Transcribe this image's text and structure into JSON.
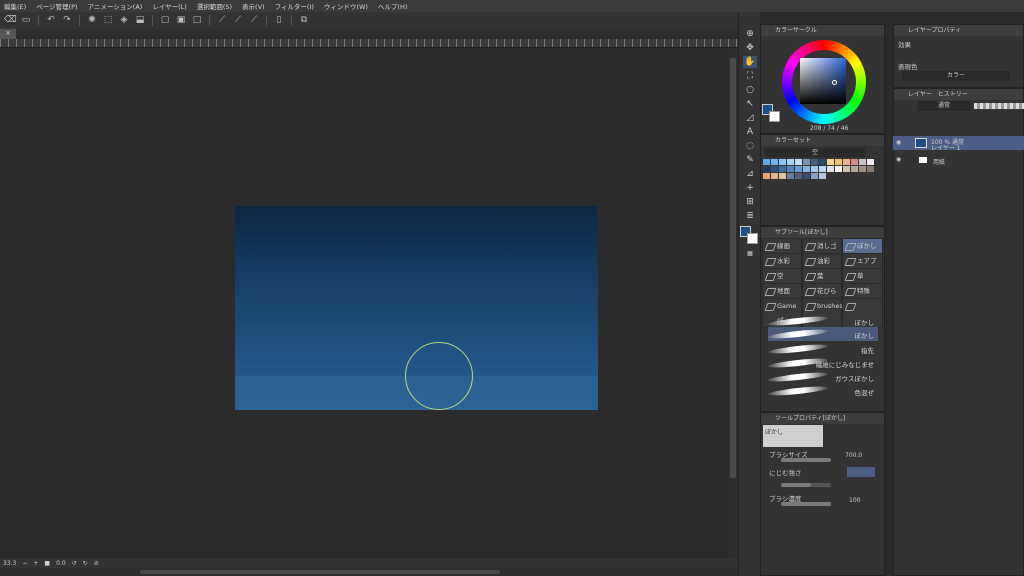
{
  "menu": [
    "編集(E)",
    "ページ管理(P)",
    "アニメーション(A)",
    "レイヤー(L)",
    "選択範囲(S)",
    "表示(V)",
    "フィルター(I)",
    "ウィンドウ(W)",
    "ヘルプ(H)"
  ],
  "canvas": {
    "tab_label": "×",
    "colors": {
      "sky_top": "#0f2540",
      "sky_bottom": "#2a6294",
      "brush_cursor": "#b7d67b"
    }
  },
  "statusbar": {
    "zoom": "33.3",
    "rotation": "0.0"
  },
  "color_circle": {
    "title": "カラーサークル",
    "hsv": {
      "h": "208",
      "s": "74",
      "v": "46"
    },
    "hsv_label": "208 / 74 / 46",
    "main_color": "#1f4f84",
    "sub_color": "#ffffff"
  },
  "color_set": {
    "title": "カラーセット",
    "dropdown": "空",
    "swatches": [
      "#5fa8e8",
      "#6fb4ee",
      "#8cc4f2",
      "#a9d2f5",
      "#c4e0f8",
      "#7a94b8",
      "#44607e",
      "#2d4b6b",
      "#f6d98a",
      "#f4c16c",
      "#e9b38c",
      "#d38f86",
      "#c9c3c9",
      "#f1ecf0",
      "#1e3a5e",
      "#2a527f",
      "#3f6da0",
      "#5587be",
      "#6ba0d6",
      "#86b6e2",
      "#a6cbee",
      "#bcd8f2",
      "#e5e1e9",
      "#fbf6f6",
      "#cfc1b4",
      "#b6a79b",
      "#9d8e84",
      "#877870",
      "#e7a37a",
      "#e2b38c",
      "#dcc29e",
      "#6d7c95",
      "#52627e",
      "#3b4b68",
      "#8aa2c8",
      "#b7c7e0"
    ]
  },
  "subtool": {
    "title": "サブツール[ぼかし]",
    "groups": [
      [
        "線画",
        "消しゴム",
        "ぼかし"
      ],
      [
        "水彩",
        "油彩",
        "エアブラシ"
      ],
      [
        "空",
        "葉",
        "草"
      ],
      [
        "地面",
        "花びら",
        "特殊"
      ],
      [
        "Game of",
        "brushes",
        ""
      ]
    ],
    "selected_group": "ぼかし",
    "brushes": [
      "ぼかし",
      "ぼかし",
      "指先",
      "繊維にじみなじませ",
      "ガウスぼかし",
      "色混ぜ"
    ],
    "selected_brush_index": 1
  },
  "tool_property": {
    "title": "ツールプロパティ[ぼかし]",
    "preview_label": "ぼかし",
    "brush_size_label": "ブラシサイズ",
    "brush_size_value": "700.0",
    "blur_strength_label": "にじむ強さ",
    "density_label": "ブラシ濃度",
    "density_value": "100"
  },
  "layer_property": {
    "title": "レイヤープロパティ",
    "effect_label": "効果",
    "expression_label": "表現色",
    "expression_value": "カラー"
  },
  "layers_panel": {
    "tab_layer": "レイヤー",
    "tab_history": "ヒストリー",
    "blend_mode": "通常",
    "layers": [
      {
        "name": "100 % 通常",
        "sub": "レイヤー 1",
        "selected": true
      },
      {
        "name": "用紙",
        "sub": "",
        "selected": false
      }
    ]
  }
}
